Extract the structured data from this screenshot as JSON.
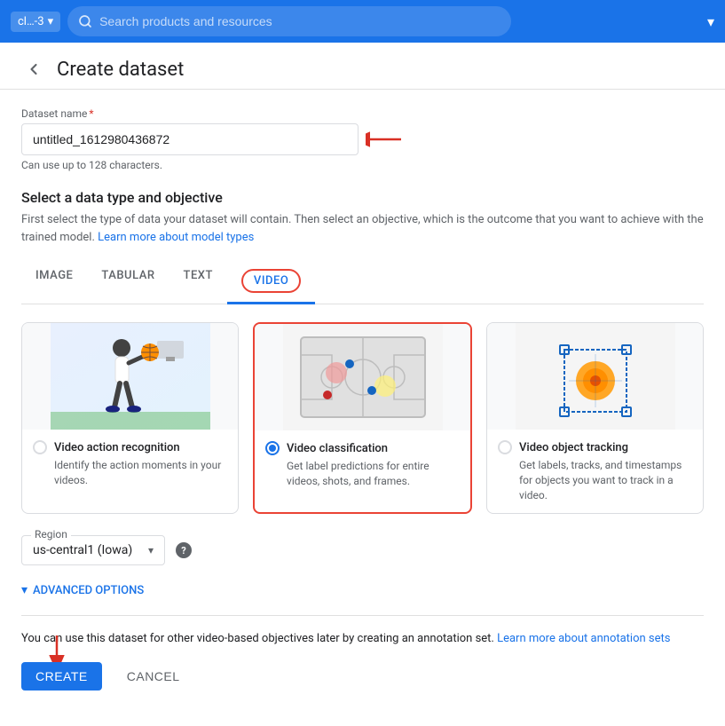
{
  "nav": {
    "project_chip": "cl…-3",
    "project_chip_dropdown": "▾",
    "search_placeholder": "Search products and resources",
    "apps_icon": "⋮⋮",
    "expand_icon": "▾"
  },
  "header": {
    "back_icon": "←",
    "title": "Create dataset"
  },
  "dataset_name_field": {
    "label": "Dataset name",
    "required_marker": "*",
    "value": "untitled_1612980436872",
    "hint": "Can use up to 128 characters."
  },
  "data_type_section": {
    "title": "Select a data type and objective",
    "description": "First select the type of data your dataset will contain. Then select an objective, which is the outcome that you want to achieve with the trained model.",
    "learn_more_text": "Learn more about model types",
    "learn_more_href": "#"
  },
  "tabs": [
    {
      "id": "image",
      "label": "IMAGE",
      "active": false
    },
    {
      "id": "tabular",
      "label": "TABULAR",
      "active": false
    },
    {
      "id": "text",
      "label": "TEXT",
      "active": false
    },
    {
      "id": "video",
      "label": "VIDEO",
      "active": true
    }
  ],
  "objectives": [
    {
      "id": "action-recognition",
      "label": "Video action recognition",
      "description": "Identify the action moments in your videos.",
      "selected": false
    },
    {
      "id": "classification",
      "label": "Video classification",
      "description": "Get label predictions for entire videos, shots, and frames.",
      "selected": true
    },
    {
      "id": "object-tracking",
      "label": "Video object tracking",
      "description": "Get labels, tracks, and timestamps for objects you want to track in a video.",
      "selected": false
    }
  ],
  "region": {
    "legend": "Region",
    "value": "us-central1 (Iowa)",
    "help_text": "?"
  },
  "advanced_options": {
    "label": "ADVANCED OPTIONS",
    "icon": "▾"
  },
  "bottom_info": {
    "text": "You can use this dataset for other video-based objectives later by creating an annotation set.",
    "learn_more_text": "Learn more about annotation sets",
    "learn_more_href": "#"
  },
  "actions": {
    "create_label": "CREATE",
    "cancel_label": "CANCEL"
  }
}
